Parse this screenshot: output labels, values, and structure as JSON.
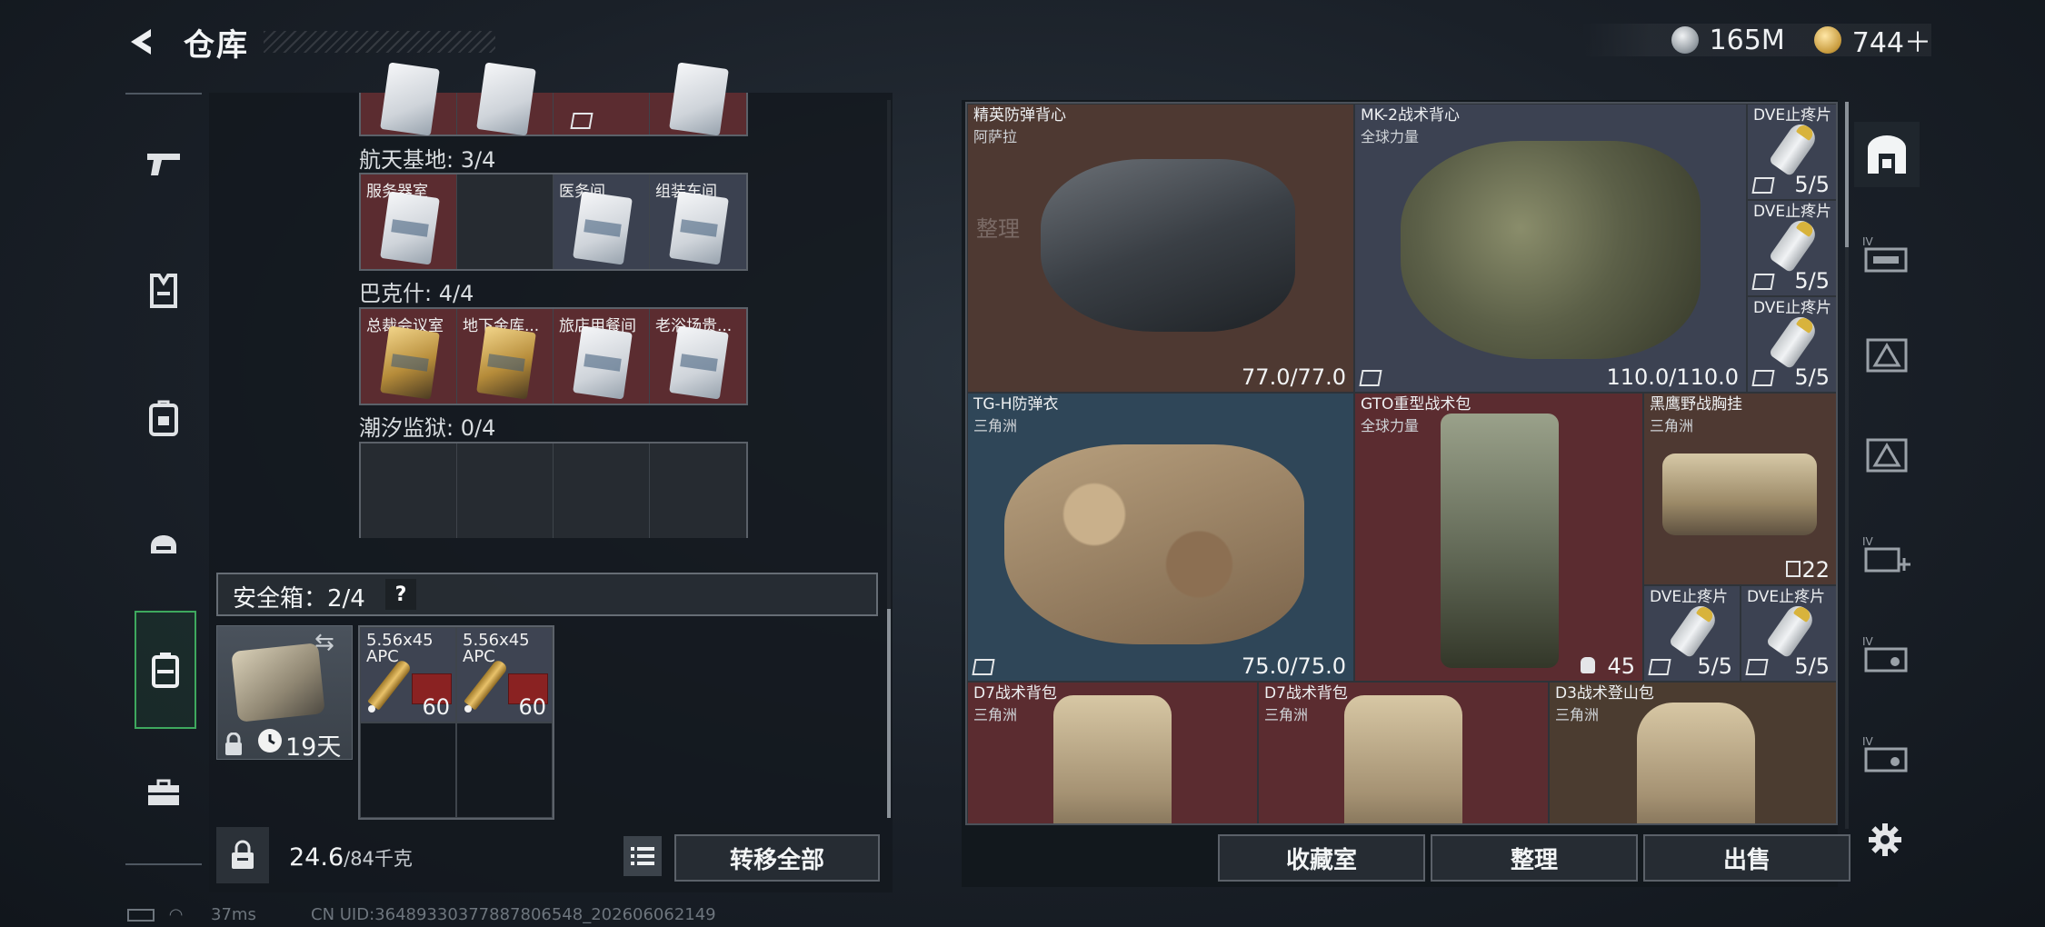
{
  "header": {
    "title": "仓库",
    "currency": [
      {
        "icon": "silver-coin-icon",
        "value": "165M"
      },
      {
        "icon": "gold-coin-icon",
        "value": "744＋"
      }
    ]
  },
  "left_rail": {
    "items": [
      {
        "name": "weapons",
        "icon": "pistol-icon"
      },
      {
        "name": "armor",
        "icon": "vest-icon"
      },
      {
        "name": "backpack",
        "icon": "backpack-icon"
      },
      {
        "name": "helmet",
        "icon": "helmet-icon"
      },
      {
        "name": "safe-case",
        "icon": "case-icon",
        "active": true
      },
      {
        "name": "toolbox",
        "icon": "toolbox-icon"
      }
    ]
  },
  "keys": {
    "sections": [
      {
        "label": "航天基地: 3/4",
        "cells": [
          {
            "name": "服务器室",
            "card": "white",
            "bg": "red"
          },
          {
            "name": "",
            "card": "",
            "bg": "dark"
          },
          {
            "name": "医务间",
            "card": "white",
            "bg": "slate"
          },
          {
            "name": "组装车间",
            "card": "white",
            "bg": "slate"
          }
        ]
      },
      {
        "label": "巴克什: 4/4",
        "cells": [
          {
            "name": "总裁会议室",
            "card": "gold",
            "bg": "red"
          },
          {
            "name": "地下金库...",
            "card": "gold",
            "bg": "red"
          },
          {
            "name": "旅店用餐间",
            "card": "white",
            "bg": "red"
          },
          {
            "name": "老浴场贵...",
            "card": "white",
            "bg": "red"
          }
        ]
      },
      {
        "label": "潮汐监狱: 0/4",
        "cells": []
      }
    ]
  },
  "safe_box": {
    "label": "安全箱：2/4",
    "help": "?",
    "days": "19天",
    "ammo": [
      {
        "name": "5.56x45",
        "sub": "APC",
        "count": "60"
      },
      {
        "name": "5.56x45",
        "sub": "APC",
        "count": "60"
      }
    ]
  },
  "weight": {
    "current": "24.6",
    "max": "/84千克"
  },
  "buttons": {
    "transfer_all": "转移全部",
    "collection": "收藏室",
    "sort": "整理",
    "sell": "出售",
    "ghost_sort": "整理"
  },
  "inventory": {
    "items": [
      {
        "id": "elite-vest",
        "name": "精英防弹背心",
        "sub": "阿萨拉",
        "value": "77.0/77.0"
      },
      {
        "id": "mk2-vest",
        "name": "MK-2战术背心",
        "sub": "全球力量",
        "value": "110.0/110.0"
      },
      {
        "id": "dve-1",
        "name": "DVE止疼片",
        "value": "5/5"
      },
      {
        "id": "dve-2",
        "name": "DVE止疼片",
        "value": "5/5"
      },
      {
        "id": "dve-3",
        "name": "DVE止疼片",
        "value": "5/5"
      },
      {
        "id": "tgh-armor",
        "name": "TG-H防弹衣",
        "sub": "三角洲",
        "value": "75.0/75.0"
      },
      {
        "id": "gto-pack",
        "name": "GTO重型战术包",
        "sub": "全球力量",
        "value": "45"
      },
      {
        "id": "black-eagle-rig",
        "name": "黑鹰野战胸挂",
        "sub": "三角洲",
        "value": "22"
      },
      {
        "id": "dve-4",
        "name": "DVE止疼片",
        "value": "5/5"
      },
      {
        "id": "dve-5",
        "name": "DVE止疼片",
        "value": "5/5"
      },
      {
        "id": "d7-pack-1",
        "name": "D7战术背包",
        "sub": "三角洲"
      },
      {
        "id": "d7-pack-2",
        "name": "D7战术背包",
        "sub": "三角洲"
      },
      {
        "id": "d3-pack",
        "name": "D3战术登山包",
        "sub": "三角洲"
      }
    ]
  },
  "right_rail": {
    "items": [
      {
        "name": "storage-main",
        "icon": "safe-arch-icon",
        "active": true
      },
      {
        "name": "storage-iv-1",
        "icon": "storage-iv-icon",
        "tag": "IV"
      },
      {
        "name": "storage-2",
        "icon": "storage-triangle-icon"
      },
      {
        "name": "storage-3",
        "icon": "storage-triangle-icon"
      },
      {
        "name": "storage-iv-add",
        "icon": "storage-iv-add-icon",
        "tag": "IV"
      },
      {
        "name": "storage-iv-2",
        "icon": "storage-iv-icon",
        "tag": "IV"
      },
      {
        "name": "storage-iv-3",
        "icon": "storage-iv-icon",
        "tag": "IV"
      }
    ]
  },
  "footer": {
    "ping": "37ms",
    "uid": "CN UID:3648933037788780654​8_202606062149"
  },
  "colors": {
    "accent_green": "#3ea85e",
    "rarity_red": "#5b2c30",
    "rarity_slate": "#3c4252",
    "rarity_blue": "#2f4658"
  }
}
